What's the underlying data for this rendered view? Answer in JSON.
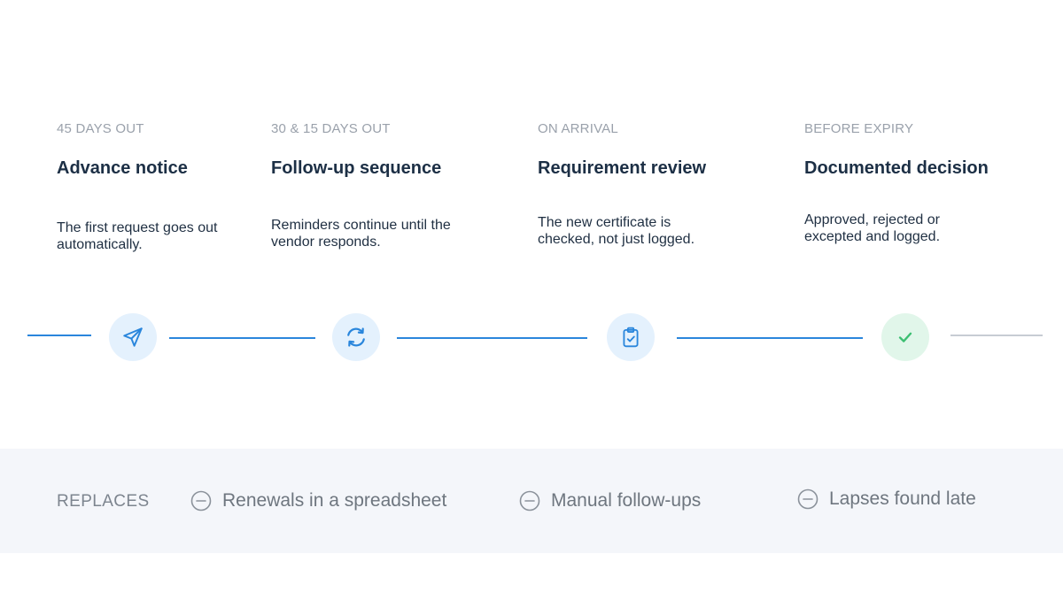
{
  "timeline": {
    "steps": [
      {
        "eyebrow": "45 DAYS OUT",
        "title": "Advance notice",
        "description": "The first request goes out automatically.",
        "icon": "paper-plane-icon"
      },
      {
        "eyebrow": "30 & 15 DAYS OUT",
        "title": "Follow-up sequence",
        "description": "Reminders continue until the vendor responds.",
        "icon": "refresh-icon"
      },
      {
        "eyebrow": "ON ARRIVAL",
        "title": "Requirement review",
        "description": "The new certificate is checked, not just logged.",
        "icon": "clipboard-check-icon"
      },
      {
        "eyebrow": "BEFORE EXPIRY",
        "title": "Documented decision",
        "description": "Approved, rejected or excepted and logged.",
        "icon": "check-icon"
      }
    ]
  },
  "colors": {
    "accent": "#2a86dc",
    "accent_soft": "#e4f1fd",
    "success": "#3cbf72",
    "success_soft": "#e1f6ea",
    "heading": "#1c2f45",
    "muted": "#9aa1ab"
  },
  "replaces": {
    "label": "REPLACES",
    "items": [
      {
        "text": "Renewals in a spreadsheet",
        "icon": "minus-circle-icon"
      },
      {
        "text": "Manual follow-ups",
        "icon": "minus-circle-icon"
      },
      {
        "text": "Lapses found late",
        "icon": "minus-circle-icon"
      }
    ]
  }
}
